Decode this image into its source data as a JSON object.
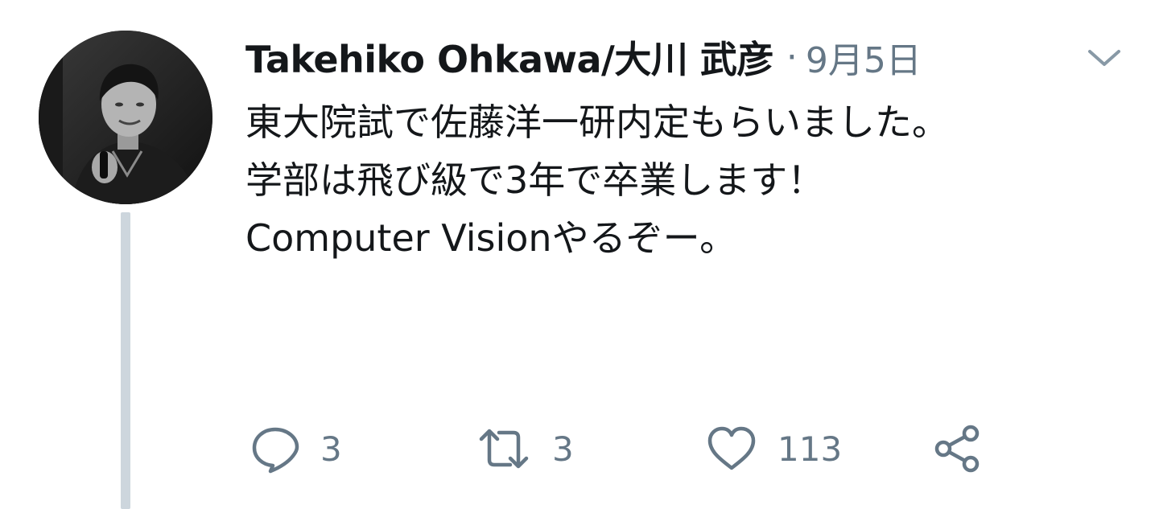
{
  "tweet": {
    "author": "Takehiko Ohkawa/大川 武彦",
    "separator": "·",
    "date": "9月5日",
    "text": "東大院試で佐藤洋一研内定もらいました。\n学部は飛び級で3年で卒業します！\nComputer Visionやるぞー。",
    "counts": {
      "replies": "3",
      "retweets": "3",
      "likes": "113"
    }
  },
  "icons": {
    "menu": "chevron-down-icon",
    "reply": "reply-icon",
    "retweet": "retweet-icon",
    "like": "heart-icon",
    "share": "share-icon"
  },
  "colors": {
    "text": "#14171a",
    "secondary": "#657786",
    "thread_line": "#cdd6dd"
  }
}
